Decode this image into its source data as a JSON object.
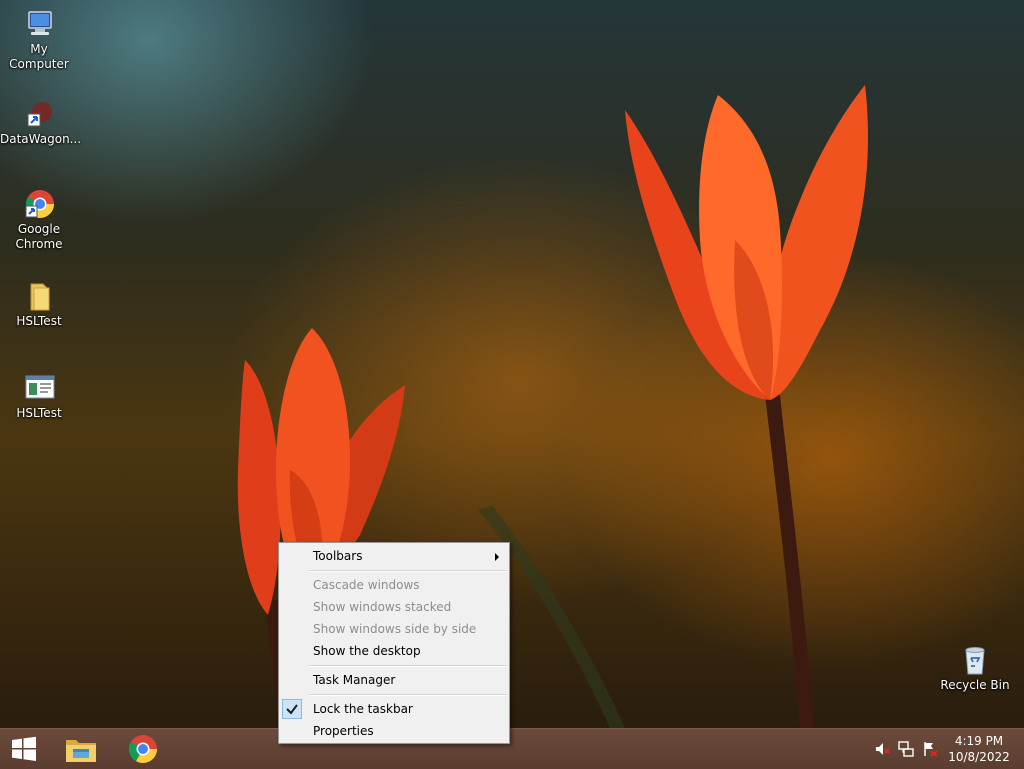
{
  "desktop": {
    "icons": [
      {
        "label": "My Computer",
        "icon": "computer-icon"
      },
      {
        "label": "DataWagon...",
        "icon": "shortcut-icon"
      },
      {
        "label": "Google Chrome",
        "icon": "chrome-icon"
      },
      {
        "label": "HSLTest",
        "icon": "folder-icon"
      },
      {
        "label": "HSLTest",
        "icon": "application-icon"
      },
      {
        "label": "Recycle Bin",
        "icon": "recycle-bin-icon"
      }
    ]
  },
  "context_menu": {
    "items": [
      {
        "label": "Toolbars",
        "enabled": true,
        "submenu": true
      },
      {
        "label": "Cascade windows",
        "enabled": false
      },
      {
        "label": "Show windows stacked",
        "enabled": false
      },
      {
        "label": "Show windows side by side",
        "enabled": false
      },
      {
        "label": "Show the desktop",
        "enabled": true
      },
      {
        "label": "Task Manager",
        "enabled": true
      },
      {
        "label": "Lock the taskbar",
        "enabled": true,
        "checked": true
      },
      {
        "label": "Properties",
        "enabled": true
      }
    ]
  },
  "taskbar": {
    "start": "windows-logo-icon",
    "pinned": [
      "file-explorer-icon",
      "chrome-icon"
    ],
    "tray": [
      "volume-muted-icon",
      "network-icon",
      "action-center-icon"
    ],
    "clock": {
      "time": "4:19 PM",
      "date": "10/8/2022"
    }
  },
  "colors": {
    "taskbar": "#5a3d30",
    "menu_bg": "#f0f0f0",
    "check_highlight": "#cde4f7"
  }
}
